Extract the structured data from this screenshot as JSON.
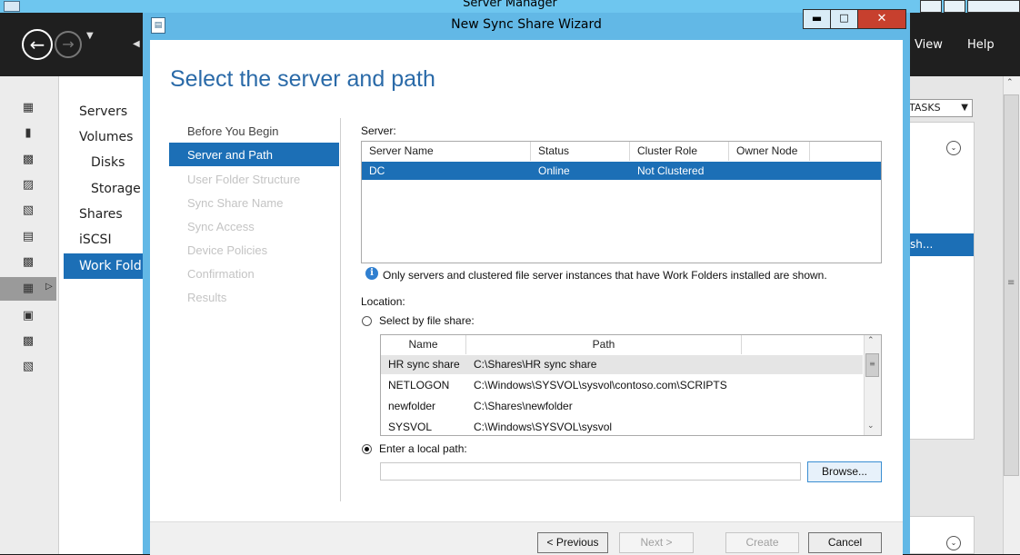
{
  "server_manager": {
    "title": "Server Manager",
    "menu": [
      "View",
      "Help"
    ],
    "nav_items": [
      "Servers",
      "Volumes",
      "Disks",
      "Storage",
      "Shares",
      "iSCSI",
      "Work Fold"
    ],
    "tasks_label": "TASKS",
    "selected_row_text": "sh..."
  },
  "wizard": {
    "title": "New Sync Share Wizard",
    "heading": "Select the server and path",
    "steps": [
      {
        "label": "Before You Begin",
        "state": "done"
      },
      {
        "label": "Server and Path",
        "state": "current"
      },
      {
        "label": "User Folder Structure",
        "state": "future"
      },
      {
        "label": "Sync Share Name",
        "state": "future"
      },
      {
        "label": "Sync Access",
        "state": "future"
      },
      {
        "label": "Device Policies",
        "state": "future"
      },
      {
        "label": "Confirmation",
        "state": "future"
      },
      {
        "label": "Results",
        "state": "future"
      }
    ],
    "server_label": "Server:",
    "server_columns": [
      "Server Name",
      "Status",
      "Cluster Role",
      "Owner Node"
    ],
    "server_rows": [
      {
        "name": "DC",
        "status": "Online",
        "cluster_role": "Not Clustered",
        "owner_node": ""
      }
    ],
    "info_text": "Only servers and clustered file server instances that have Work Folders installed are shown.",
    "location_label": "Location:",
    "option_file_share": "Select by file share:",
    "share_columns": [
      "Name",
      "Path"
    ],
    "share_rows": [
      {
        "name": "HR sync share",
        "path": "C:\\Shares\\HR sync share"
      },
      {
        "name": "NETLOGON",
        "path": "C:\\Windows\\SYSVOL\\sysvol\\contoso.com\\SCRIPTS"
      },
      {
        "name": "newfolder",
        "path": "C:\\Shares\\newfolder"
      },
      {
        "name": "SYSVOL",
        "path": "C:\\Windows\\SYSVOL\\sysvol"
      }
    ],
    "option_local_path": "Enter a local path:",
    "local_path_value": "",
    "selected_option": "local_path",
    "buttons": {
      "browse": "Browse...",
      "previous": "< Previous",
      "next": "Next >",
      "create": "Create",
      "cancel": "Cancel"
    }
  },
  "colors": {
    "accent": "#1c6fb6",
    "window_frame": "#62b8e6",
    "heading": "#2a6aa8",
    "close_button": "#c7402e"
  }
}
